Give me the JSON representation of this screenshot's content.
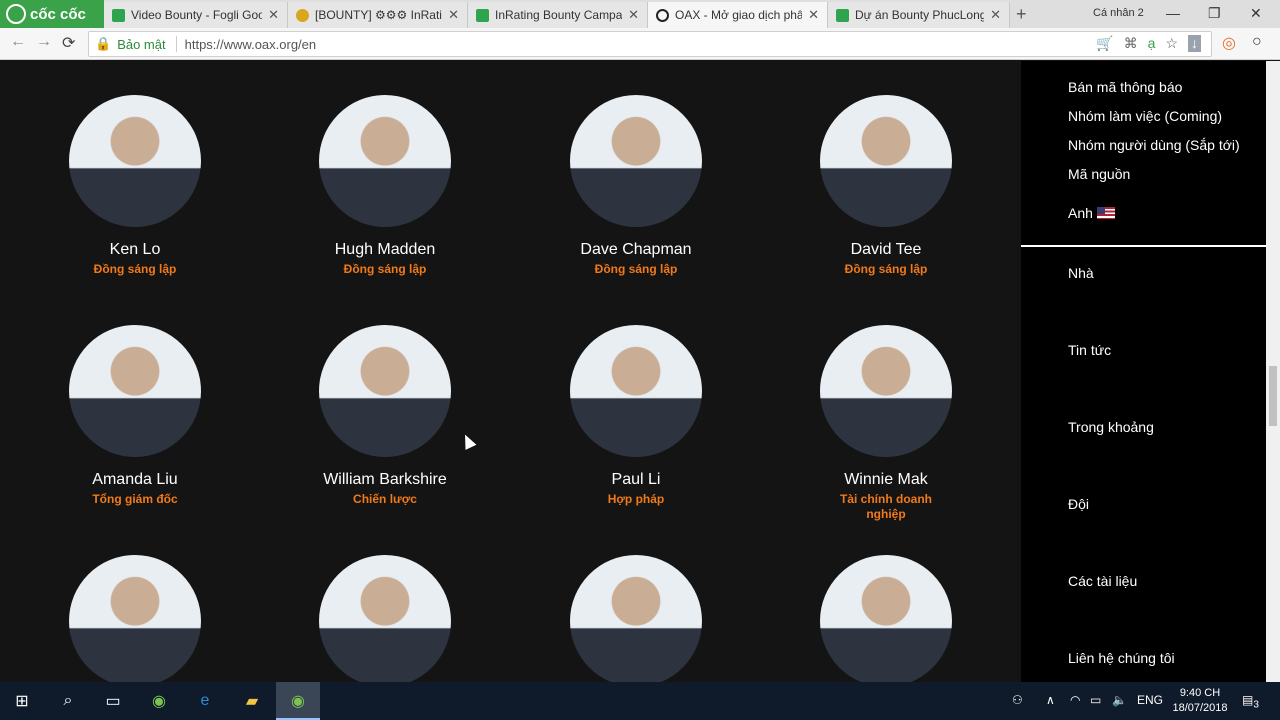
{
  "browser": {
    "logo_text": "cốc cốc",
    "tabs": [
      {
        "title": "Video Bounty - Fogli Goo",
        "icon": "sheets-icon"
      },
      {
        "title": "[BOUNTY] ⚙⚙⚙ InRatin",
        "icon": "forum-icon"
      },
      {
        "title": "InRating Bounty Campaign",
        "icon": "sheets-icon"
      },
      {
        "title": "OAX - Mở giao dịch phân",
        "icon": "oax-icon"
      },
      {
        "title": "Dự án Bounty PhucLongSt",
        "icon": "sheets-icon"
      }
    ],
    "profile": "Cá nhân 2",
    "secure_label": "Bảo mật",
    "url": "https://www.oax.org/en"
  },
  "team": [
    {
      "name": "Ken Lo",
      "role": "Đồng sáng lập"
    },
    {
      "name": "Hugh Madden",
      "role": "Đồng sáng lập"
    },
    {
      "name": "Dave Chapman",
      "role": "Đồng sáng lập"
    },
    {
      "name": "David Tee",
      "role": "Đồng sáng lập"
    },
    {
      "name": "Amanda Liu",
      "role": "Tổng giám đốc"
    },
    {
      "name": "William Barkshire",
      "role": "Chiến lược"
    },
    {
      "name": "Paul Li",
      "role": "Hợp pháp"
    },
    {
      "name": "Winnie Mak",
      "role": "Tài chính doanh nghiệp"
    },
    {
      "name": "",
      "role": ""
    },
    {
      "name": "",
      "role": ""
    },
    {
      "name": "",
      "role": ""
    },
    {
      "name": "",
      "role": ""
    }
  ],
  "sidemenu": {
    "top_items": [
      "Bán mã thông báo",
      "Nhóm làm việc (Coming)",
      "Nhóm người dùng (Sắp tới)",
      "Mã nguồn"
    ],
    "language": "Anh",
    "nav_items": [
      "Nhà",
      "Tin tức",
      "Trong khoảng",
      "Đội",
      "Các tài liệu",
      "Liên hệ chúng tôi"
    ]
  },
  "taskbar": {
    "language": "ENG",
    "time": "9:40 CH",
    "date": "18/07/2018",
    "notifications": "3"
  },
  "colors": {
    "accent_orange": "#f07a1a",
    "page_bg": "#141414",
    "menu_bg": "#000000"
  }
}
